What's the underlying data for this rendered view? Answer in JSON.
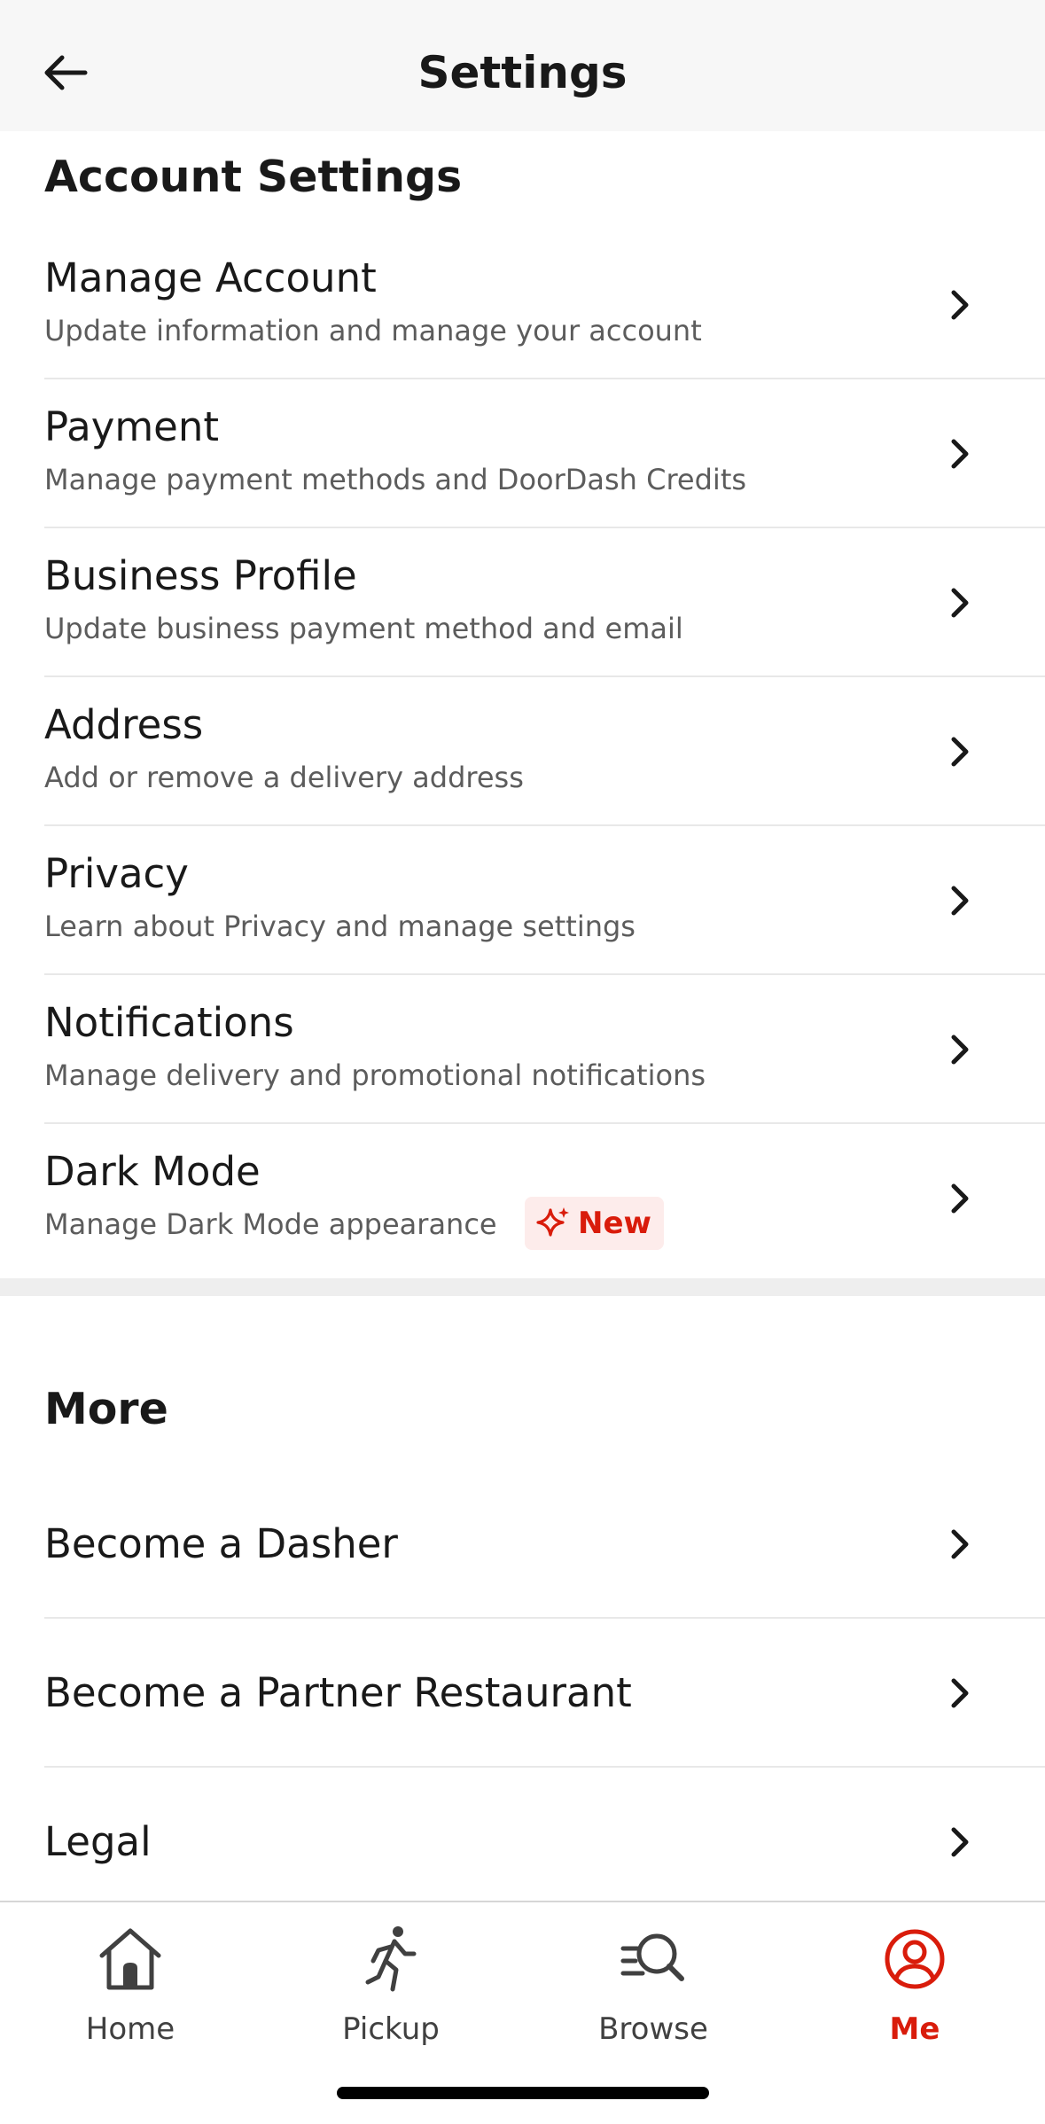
{
  "header": {
    "title": "Settings"
  },
  "account_section": {
    "title": "Account Settings",
    "items": [
      {
        "title": "Manage Account",
        "subtitle": "Update information and manage your account"
      },
      {
        "title": "Payment",
        "subtitle": "Manage payment methods and DoorDash Credits"
      },
      {
        "title": "Business Profile",
        "subtitle": "Update business payment method and email"
      },
      {
        "title": "Address",
        "subtitle": "Add or remove a delivery address"
      },
      {
        "title": "Privacy",
        "subtitle": "Learn about Privacy and manage settings"
      },
      {
        "title": "Notifications",
        "subtitle": "Manage delivery and promotional notifications"
      },
      {
        "title": "Dark Mode",
        "subtitle": "Manage Dark Mode appearance",
        "badge": "New"
      }
    ]
  },
  "more_section": {
    "title": "More",
    "items": [
      {
        "title": "Become a Dasher"
      },
      {
        "title": "Become a Partner Restaurant"
      },
      {
        "title": "Legal"
      }
    ]
  },
  "tabbar": {
    "tabs": [
      {
        "label": "Home",
        "icon": "home-icon"
      },
      {
        "label": "Pickup",
        "icon": "pickup-icon"
      },
      {
        "label": "Browse",
        "icon": "browse-icon"
      },
      {
        "label": "Me",
        "icon": "me-icon",
        "active": true
      }
    ]
  },
  "colors": {
    "accent": "#d91c0b",
    "badge_bg": "#fdeceb",
    "header_bg": "#f7f7f7"
  }
}
